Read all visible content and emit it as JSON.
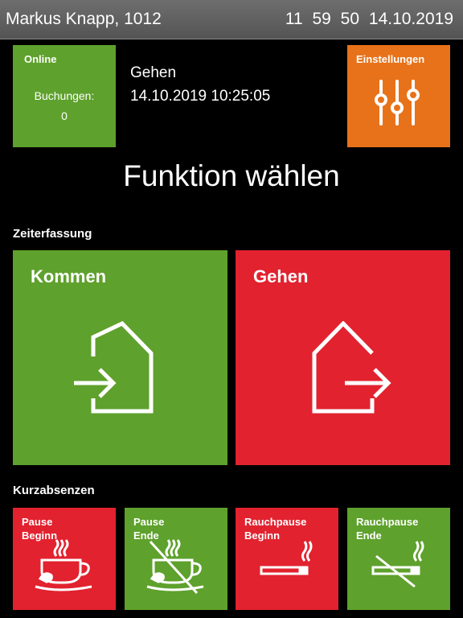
{
  "header": {
    "user": "Markus Knapp, 1012",
    "time": "11 59 50",
    "date": "14.10.2019"
  },
  "status": {
    "online_label": "Online",
    "bookings_label": "Buchungen:",
    "bookings_count": "0"
  },
  "last_action": {
    "type": "Gehen",
    "timestamp": "14.10.2019 10:25:05"
  },
  "settings": {
    "label": "Einstellungen",
    "icon": "sliders-icon"
  },
  "title": "Funktion wählen",
  "sections": {
    "time_tracking": "Zeiterfassung",
    "short_absences": "Kurzabsenzen"
  },
  "time_tracking": {
    "kommen": {
      "label": "Kommen",
      "icon": "enter-house-icon"
    },
    "gehen": {
      "label": "Gehen",
      "icon": "leave-house-icon"
    }
  },
  "short_absences": [
    {
      "label": "Pause Beginn",
      "icon": "coffee-cup-icon"
    },
    {
      "label": "Pause Ende",
      "icon": "coffee-cup-crossed-icon"
    },
    {
      "label": "Rauchpause Beginn",
      "icon": "cigarette-icon"
    },
    {
      "label": "Rauchpause Ende",
      "icon": "cigarette-crossed-icon"
    }
  ],
  "colors": {
    "green": "#5ea12c",
    "red": "#e2222f",
    "orange": "#e8721a",
    "header": "#5e5e5e"
  }
}
